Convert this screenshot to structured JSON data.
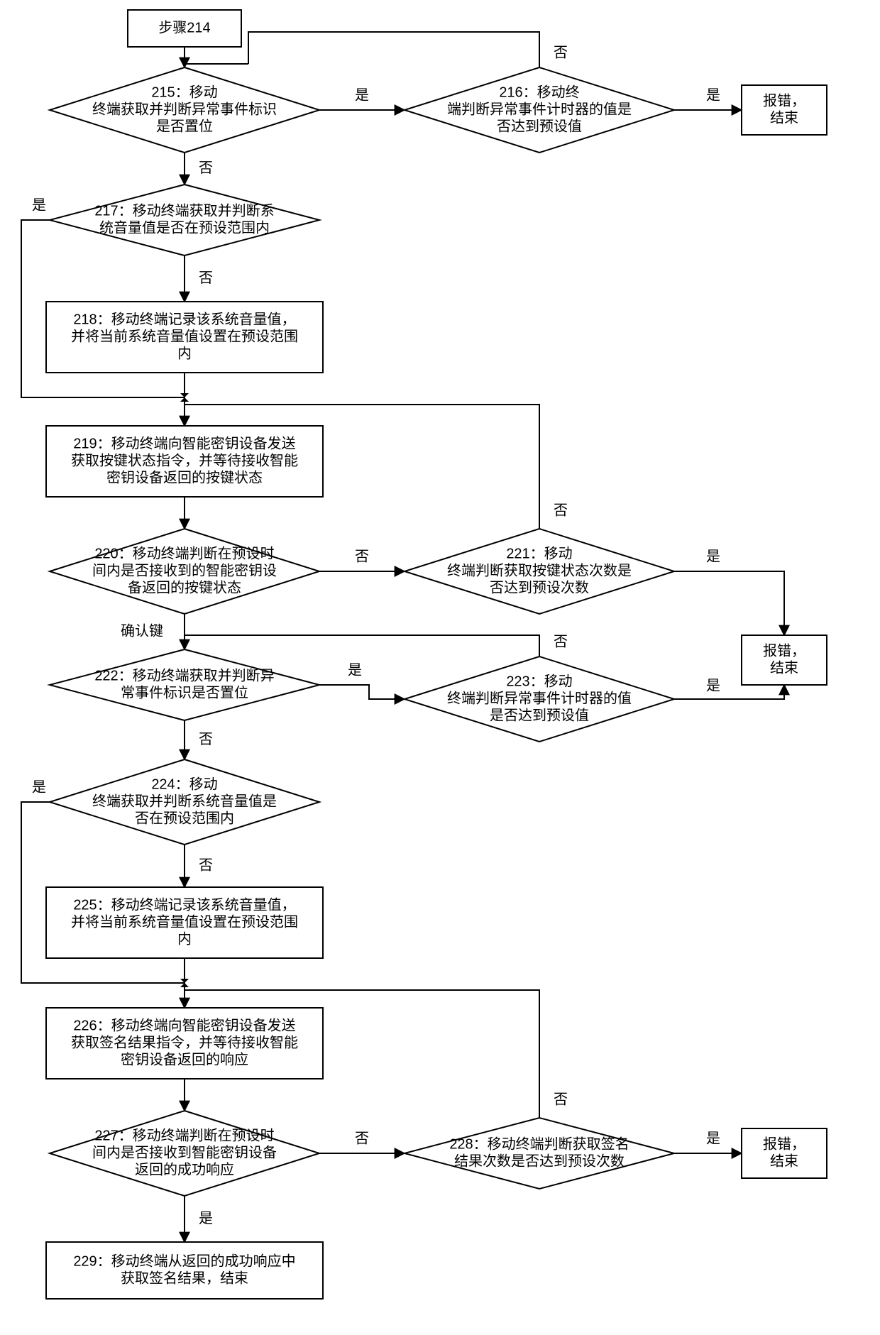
{
  "nodes": {
    "n214": {
      "lines": [
        "步骤214"
      ]
    },
    "n215": {
      "lines": [
        "215：移动",
        "终端获取并判断异常事件标识",
        "是否置位"
      ]
    },
    "n216": {
      "lines": [
        "216：移动终",
        "端判断异常事件计时器的值是",
        "否达到预设值"
      ]
    },
    "err1": {
      "lines": [
        "报错，",
        "结束"
      ]
    },
    "n217": {
      "lines": [
        "217：移动终端获取并判断系",
        "统音量值是否在预设范围内"
      ]
    },
    "n218": {
      "lines": [
        "218：移动终端记录该系统音量值，",
        "并将当前系统音量值设置在预设范围",
        "内"
      ]
    },
    "n219": {
      "lines": [
        "219：移动终端向智能密钥设备发送",
        "获取按键状态指令，并等待接收智能",
        "密钥设备返回的按键状态"
      ]
    },
    "n220": {
      "lines": [
        "220：移动终端判断在预设时",
        "间内是否接收到的智能密钥设",
        "备返回的按键状态"
      ]
    },
    "n221": {
      "lines": [
        "221：移动",
        "终端判断获取按键状态次数是",
        "否达到预设次数"
      ]
    },
    "err2": {
      "lines": [
        "报错，",
        "结束"
      ]
    },
    "n222": {
      "lines": [
        "222：移动终端获取并判断异",
        "常事件标识是否置位"
      ]
    },
    "n223": {
      "lines": [
        "223：移动",
        "终端判断异常事件计时器的值",
        "是否达到预设值"
      ]
    },
    "n224": {
      "lines": [
        "224：移动",
        "终端获取并判断系统音量值是",
        "否在预设范围内"
      ]
    },
    "n225": {
      "lines": [
        "225：移动终端记录该系统音量值，",
        "并将当前系统音量值设置在预设范围",
        "内"
      ]
    },
    "n226": {
      "lines": [
        "226：移动终端向智能密钥设备发送",
        "获取签名结果指令，并等待接收智能",
        "密钥设备返回的响应"
      ]
    },
    "n227": {
      "lines": [
        "227：移动终端判断在预设时",
        "间内是否接收到智能密钥设备",
        "返回的成功响应"
      ]
    },
    "n228": {
      "lines": [
        "228：移动终端判断获取签名",
        "结果次数是否达到预设次数"
      ]
    },
    "err3": {
      "lines": [
        "报错，",
        "结束"
      ]
    },
    "n229": {
      "lines": [
        "229：移动终端从返回的成功响应中",
        "获取签名结果，结束"
      ]
    }
  },
  "labels": {
    "yes": "是",
    "no": "否",
    "confirm": "确认键"
  }
}
